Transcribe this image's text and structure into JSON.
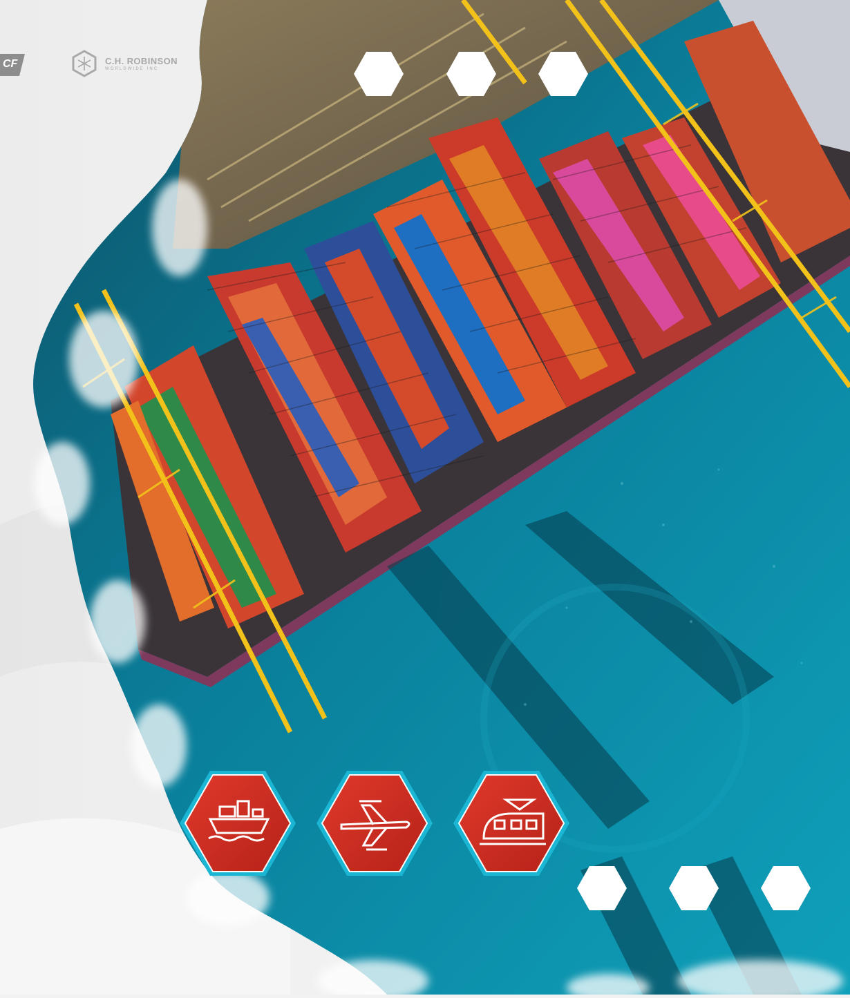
{
  "logos": {
    "partner_partial_text": "CF",
    "company_name": "C.H. ROBINSON",
    "company_subtitle": "WORLDWIDE INC"
  },
  "transport_modes": [
    {
      "icon": "cargo-ship-icon"
    },
    {
      "icon": "airplane-icon"
    },
    {
      "icon": "train-icon"
    }
  ],
  "colors": {
    "accent_red": "#d62d20",
    "accent_cyan": "#1ab6d3",
    "sea": "#0a7d99",
    "crane_yellow": "#f2c21b"
  }
}
